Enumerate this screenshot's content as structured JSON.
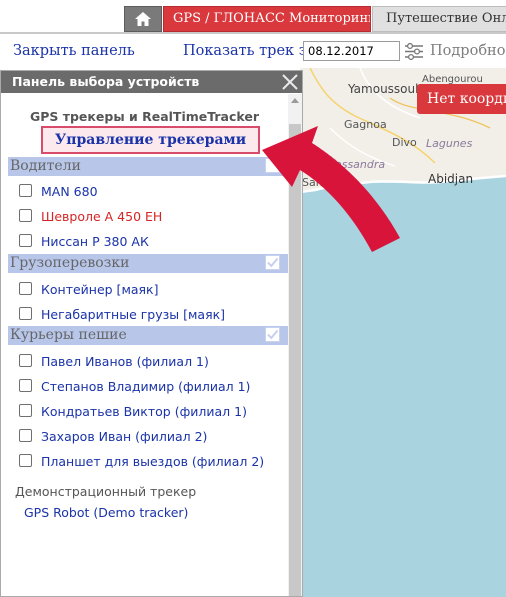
{
  "nav": {
    "home_icon": "home-icon",
    "tabs": [
      {
        "label": "GPS / ГЛОНАСС Мониторинг",
        "active": true
      },
      {
        "label": "Путешествие Онлай",
        "active": false
      }
    ]
  },
  "toolbar": {
    "close_panel": "Закрыть панель",
    "show_track": "Показать трек за",
    "date": "08.12.2017",
    "details": "Подробно"
  },
  "map": {
    "labels": {
      "yamoussoukro": "Yamoussoukro",
      "ahoua": "Abengourou",
      "gagnoa": "Gagnoa",
      "divo": "Divo",
      "lagunes": "Lagunes",
      "sassandra": "Bas-Sassandra",
      "sanpedro": "San-Pédro",
      "abidjan": "Abidjan"
    },
    "no_coords": "Нет координ"
  },
  "panel": {
    "title": "Панель выбора устройств",
    "group_title": "GPS трекеры и RealTimeTracker",
    "manage_button": "Управление трекерами",
    "categories": [
      {
        "name": "Водители",
        "items": [
          "MAN 680",
          "Шевроле А 450 ЕН",
          "Ниссан Р 380 АК"
        ]
      },
      {
        "name": "Грузоперевозки",
        "items": [
          "Контейнер [маяк]",
          "Негабаритные грузы [маяк]"
        ]
      },
      {
        "name": "Курьеры пешие",
        "items": [
          "Павел Иванов (филиал 1)",
          "Степанов Владимир (филиал 1)",
          "Кондратьев Виктор (филиал 1)",
          "Захаров Иван (филиал 2)",
          "Планшет для выездов (филиал 2)"
        ]
      }
    ],
    "demo_title": "Демонстрационный трекер",
    "demo_link": "GPS Robot (Demo tracker)"
  },
  "colors": {
    "accent_red": "#d9383c",
    "link_blue": "#1a33a8",
    "category_bar": "#b8c6ea",
    "arrow": "#d8143a"
  }
}
